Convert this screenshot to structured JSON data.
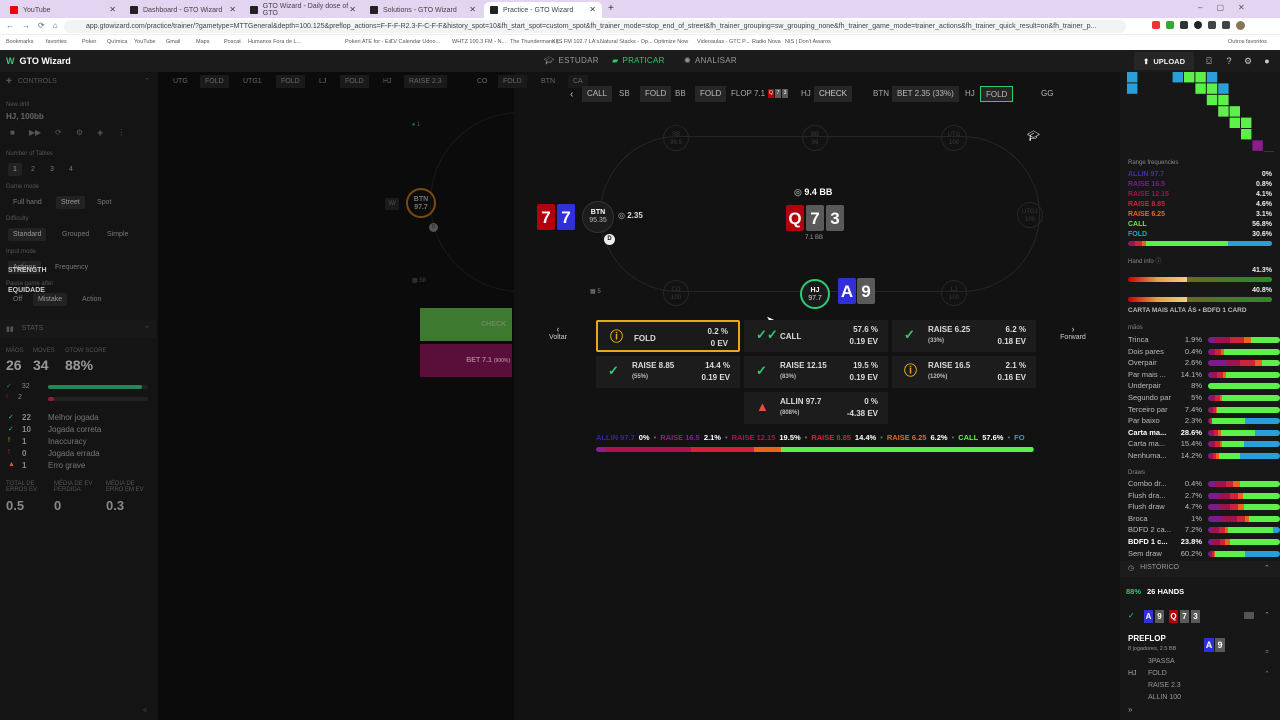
{
  "browser": {
    "tabs": [
      {
        "label": "YouTube",
        "color": "#e00"
      },
      {
        "label": "Dashboard - GTO Wizard",
        "color": "#222"
      },
      {
        "label": "GTO Wizard - Daily dose of GTO",
        "color": "#222"
      },
      {
        "label": "Solutions - GTO Wizard",
        "color": "#222"
      },
      {
        "label": "Practice - GTO Wizard",
        "color": "#222"
      }
    ],
    "new_tab": "+",
    "url": "app.gtowizard.com/practice/trainer/?gametype=MTTGeneral&depth=100.125&preflop_actions=F-F-F-R2.3-F-C-F-F&history_spot=10&fh_start_spot=custom_spot&fh_trainer_mode=stop_end_of_street&fh_trainer_grouping=sw_grouping_none&fh_trainer_game_mode=trainer_actions&fh_trainer_quick_result=on&fh_trainer_p...",
    "bookmarks": [
      "Bookmarks",
      "favorites",
      "Poker",
      "Química",
      "YouTube",
      "Gmail",
      "Maps",
      "Poscat",
      "Humanos Fora de L...",
      "",
      "Pokeri ATE for - Es...",
      "TV Calendar Udoo...",
      "WHTZ 100.3 FM - N...",
      "The Thundermans |...",
      "KIIS FM 102.7 LA's...",
      "Natural Stacks - Op...",
      "Optimize Now",
      "Videoaulas - GTC P...",
      "Radio Nova",
      "NIS | Don't Awaros"
    ],
    "other_favorites": "Outros favoritos"
  },
  "app": {
    "brand": "GTO Wizard",
    "nav": [
      {
        "label": "ESTUDAR",
        "active": false
      },
      {
        "label": "PRATICAR",
        "active": true
      },
      {
        "label": "ANALISAR",
        "active": false
      }
    ],
    "upload": "UPLOAD",
    "accent": "#2ecc71"
  },
  "controls": {
    "title": "CONTROLS",
    "new_drill_label": "New drill",
    "drill": "HJ, 100bb",
    "tables_label": "Number of Tables",
    "tables": [
      "1",
      "2",
      "3",
      "4"
    ],
    "game_mode_label": "Game mode",
    "game_mode": [
      "Full hand",
      "Street",
      "Spot"
    ],
    "difficulty_label": "Difficulty",
    "difficulty": [
      "Standard",
      "Grouped",
      "Simple"
    ],
    "input_mode_label": "Input mode",
    "input_mode": [
      "Actions",
      "Frequency"
    ],
    "pause_label": "Pause game after",
    "pause": [
      "Off",
      "Mistake",
      "Action"
    ]
  },
  "stats": {
    "title": "STATS",
    "headers": [
      "MÃOS",
      "MOVES",
      "GTOW SCORE"
    ],
    "values": [
      "26",
      "34",
      "88%"
    ],
    "good": "32",
    "bad": "2",
    "good_fraction": 0.94,
    "bad_fraction": 0.06,
    "breakdown": [
      {
        "count": "22",
        "label": "Melhor jogada",
        "color": "#2ecc71",
        "icon": "✓"
      },
      {
        "count": "10",
        "label": "Jogada correta",
        "color": "#2ecc71",
        "icon": "✓"
      },
      {
        "count": "1",
        "label": "Inaccuracy",
        "color": "#e6a817",
        "icon": "!"
      },
      {
        "count": "0",
        "label": "Jogada errada",
        "color": "#c0392b",
        "icon": "!"
      },
      {
        "count": "1",
        "label": "Erro grave",
        "color": "#e74c3c",
        "icon": "▲"
      }
    ],
    "totals_labels": [
      "TOTAL DE ERROS EV",
      "MÉDIA DE EV PERDIDA",
      "MÉDIA DE ERRO EM EV"
    ],
    "totals_values": [
      "0.5",
      "0",
      "0.3"
    ]
  },
  "mini_history": [
    {
      "pos": "UTG",
      "act": "FOLD"
    },
    {
      "pos": "UTG1",
      "act": "FOLD"
    },
    {
      "pos": "LJ",
      "act": "FOLD"
    },
    {
      "pos": "HJ",
      "act": "RAISE 2.3"
    },
    {
      "pos": "CO",
      "act": "FOLD"
    },
    {
      "pos": "BTN",
      "act": "CA"
    }
  ],
  "mini_table": {
    "hand_count": "1",
    "btn_label": "BTN",
    "btn_stack": "97.7",
    "w_label": "W/",
    "bb_count": "58",
    "check_label": "CHECK",
    "bet_label": "BET 7.1",
    "bet_pct": "(900%)"
  },
  "action_history": [
    {
      "pos": "",
      "act": "CALL",
      "box": true
    },
    {
      "pos": "SB",
      "act": "FOLD",
      "box": true
    },
    {
      "pos": "BB",
      "act": "FOLD",
      "box": true
    },
    {
      "pos": "FLOP 7.1",
      "act": "",
      "box": false
    },
    {
      "pos": "HJ",
      "act": "CHECK",
      "box": true
    },
    {
      "pos": "BTN",
      "act": "BET 2.35 (33%)",
      "box": true
    },
    {
      "pos": "HJ",
      "act": "FOLD",
      "box": true
    },
    {
      "pos": "",
      "act": "GG",
      "box": false
    }
  ],
  "table": {
    "seats": [
      {
        "pos": "SB",
        "stack": "99.5"
      },
      {
        "pos": "BB",
        "stack": "99"
      },
      {
        "pos": "UTG",
        "stack": "100"
      },
      {
        "pos": "UTG1",
        "stack": "100"
      },
      {
        "pos": "LJ",
        "stack": "100"
      },
      {
        "pos": "CO",
        "stack": "100"
      }
    ],
    "villain": {
      "pos": "BTN",
      "stack": "95.35",
      "bet": "2.35",
      "cards": [
        "7",
        "7"
      ]
    },
    "hero": {
      "pos": "HJ",
      "stack": "97.7",
      "cards": [
        "A",
        "9"
      ]
    },
    "pot": "9.4 BB",
    "pot_sub": "7.1 BB",
    "board": [
      "Q",
      "7",
      "3"
    ],
    "dealer": "D",
    "count": "5"
  },
  "actions": [
    {
      "name": "FOLD",
      "size": "",
      "pct": "0.2 %",
      "ev": "0 EV",
      "icon": "info",
      "color": "#e6a817",
      "selected": true
    },
    {
      "name": "CALL",
      "size": "",
      "pct": "57.6 %",
      "ev": "0.19 EV",
      "icon": "double-check",
      "color": "#2ecc71"
    },
    {
      "name": "RAISE 6.25",
      "size": "(33%)",
      "pct": "6.2 %",
      "ev": "0.18 EV",
      "icon": "check",
      "color": "#2ecc71"
    },
    {
      "name": "RAISE 8.85",
      "size": "(55%)",
      "pct": "14.4 %",
      "ev": "0.19 EV",
      "icon": "check",
      "color": "#2ecc71"
    },
    {
      "name": "RAISE 12.15",
      "size": "(83%)",
      "pct": "19.5 %",
      "ev": "0.19 EV",
      "icon": "check",
      "color": "#2ecc71"
    },
    {
      "name": "RAISE 16.5",
      "size": "(120%)",
      "pct": "2.1 %",
      "ev": "0.16 EV",
      "icon": "info",
      "color": "#e6a817"
    },
    {
      "name": "ALLIN 97.7",
      "size": "(808%)",
      "pct": "0 %",
      "ev": "-4.38 EV",
      "icon": "warning",
      "color": "#e74c3c"
    }
  ],
  "nav_buttons": {
    "back": "Voltar",
    "forward": "Forward"
  },
  "freq_strip": [
    {
      "label": "ALLIN 97.7",
      "value": "0%",
      "color": "#3b1fb5",
      "frac": 0.0
    },
    {
      "label": "RAISE 16.5",
      "value": "2.1%",
      "color": "#8e1c8e",
      "frac": 0.021
    },
    {
      "label": "RAISE 12.15",
      "value": "19.5%",
      "color": "#b0124e",
      "frac": 0.195
    },
    {
      "label": "RAISE 8.85",
      "value": "14.4%",
      "color": "#d0223a",
      "frac": 0.144
    },
    {
      "label": "RAISE 6.25",
      "value": "6.2%",
      "color": "#e8661a",
      "frac": 0.062
    },
    {
      "label": "CALL",
      "value": "57.6%",
      "color": "#5ef04a",
      "frac": 0.576
    },
    {
      "label": "FO",
      "value": "",
      "color": "#2a9ed6",
      "frac": 0.002
    }
  ],
  "range_frequencies": {
    "title": "Range frequencies",
    "items": [
      {
        "label": "ALLIN 97.7",
        "value": "0%",
        "color": "#3b2fb5",
        "frac": 0.0
      },
      {
        "label": "RAISE 16.5",
        "value": "0.8%",
        "color": "#7a1c8e",
        "frac": 0.008
      },
      {
        "label": "RAISE 12.15",
        "value": "4.1%",
        "color": "#a0124e",
        "frac": 0.041
      },
      {
        "label": "RAISE 8.85",
        "value": "4.6%",
        "color": "#d0223a",
        "frac": 0.046
      },
      {
        "label": "RAISE 6.25",
        "value": "3.1%",
        "color": "#e8661a",
        "frac": 0.031
      },
      {
        "label": "CALL",
        "value": "56.8%",
        "color": "#5ef04a",
        "frac": 0.568
      },
      {
        "label": "FOLD",
        "value": "30.6%",
        "color": "#2a9ed6",
        "frac": 0.306
      }
    ]
  },
  "hand_info": {
    "title": "Hand info",
    "strength_label": "STRENGTH",
    "strength": "41.3%",
    "strength_frac": 0.413,
    "equity_label": "EQUIDADE",
    "equity": "40.8%",
    "equity_frac": 0.408,
    "summary": "CARTA MAIS ALTA ÁS • BDFD 1 CARD"
  },
  "made_hands": {
    "title": "mãos",
    "rows": [
      {
        "n": "Trinca",
        "v": "1.9%",
        "mix": [
          0,
          0.1,
          0.2,
          0.2,
          0.1,
          0.4,
          0
        ]
      },
      {
        "n": "Dois pares",
        "v": "0.4%",
        "mix": [
          0,
          0.05,
          0.05,
          0.08,
          0.04,
          0.78,
          0
        ]
      },
      {
        "n": "Overpair",
        "v": "2.6%",
        "mix": [
          0,
          0.25,
          0.2,
          0.2,
          0.1,
          0.25,
          0
        ]
      },
      {
        "n": "Par mais ...",
        "v": "14.1%",
        "mix": [
          0,
          0.05,
          0.08,
          0.08,
          0.04,
          0.75,
          0
        ]
      },
      {
        "n": "Underpair",
        "v": "8%",
        "mix": [
          0,
          0,
          0,
          0,
          0,
          1,
          0
        ]
      },
      {
        "n": "Segundo par",
        "v": "5%",
        "mix": [
          0,
          0.04,
          0.06,
          0.06,
          0.04,
          0.8,
          0
        ]
      },
      {
        "n": "Terceiro par",
        "v": "7.4%",
        "mix": [
          0,
          0.03,
          0.04,
          0.04,
          0.02,
          0.87,
          0
        ]
      },
      {
        "n": "Par baixo",
        "v": "2.3%",
        "mix": [
          0,
          0.01,
          0.02,
          0.02,
          0.01,
          0.46,
          0.48
        ]
      },
      {
        "n": "Carta ma...",
        "v": "28.6%",
        "mix": [
          0,
          0.04,
          0.05,
          0.05,
          0.04,
          0.48,
          0.34
        ],
        "bold": true
      },
      {
        "n": "Carta ma...",
        "v": "15.4%",
        "mix": [
          0,
          0.04,
          0.06,
          0.06,
          0.04,
          0.3,
          0.5
        ]
      },
      {
        "n": "Nenhuma...",
        "v": "14.2%",
        "mix": [
          0,
          0.03,
          0.04,
          0.04,
          0.04,
          0.3,
          0.55
        ]
      }
    ]
  },
  "draws": {
    "title": "Draws",
    "rows": [
      {
        "n": "Combo dr...",
        "v": "0.4%",
        "mix": [
          0,
          0.1,
          0.15,
          0.1,
          0.1,
          0.55,
          0
        ]
      },
      {
        "n": "Flush dra...",
        "v": "2.7%",
        "mix": [
          0,
          0.15,
          0.15,
          0.12,
          0.06,
          0.52,
          0
        ]
      },
      {
        "n": "Flush draw",
        "v": "4.7%",
        "mix": [
          0,
          0.15,
          0.15,
          0.12,
          0.08,
          0.5,
          0
        ]
      },
      {
        "n": "Broca",
        "v": "1%",
        "mix": [
          0,
          0.2,
          0.2,
          0.12,
          0.05,
          0.43,
          0
        ]
      },
      {
        "n": "BDFD 2 ca...",
        "v": "7.2%",
        "mix": [
          0,
          0.05,
          0.1,
          0.08,
          0.05,
          0.62,
          0.1
        ]
      },
      {
        "n": "BDFD 1 c...",
        "v": "23.8%",
        "mix": [
          0,
          0.06,
          0.1,
          0.08,
          0.06,
          0.7,
          0
        ],
        "bold": true
      },
      {
        "n": "Sem draw",
        "v": "60.2%",
        "mix": [
          0,
          0.02,
          0.03,
          0.03,
          0.02,
          0.42,
          0.48
        ]
      }
    ]
  },
  "history": {
    "title": "HISTÓRICO",
    "score": "88%",
    "hands": "26 HANDS",
    "entry_cards": [
      "A",
      "9",
      "Q",
      "7",
      "3"
    ],
    "street": "PREFLOP",
    "street_sub": "8 jogadores, 2.5 BB",
    "street_cards": [
      "A",
      "9"
    ],
    "pos": "HJ",
    "options": [
      "3PASSA",
      "FOLD",
      "RAISE 2.3",
      "ALLIN 100"
    ]
  }
}
